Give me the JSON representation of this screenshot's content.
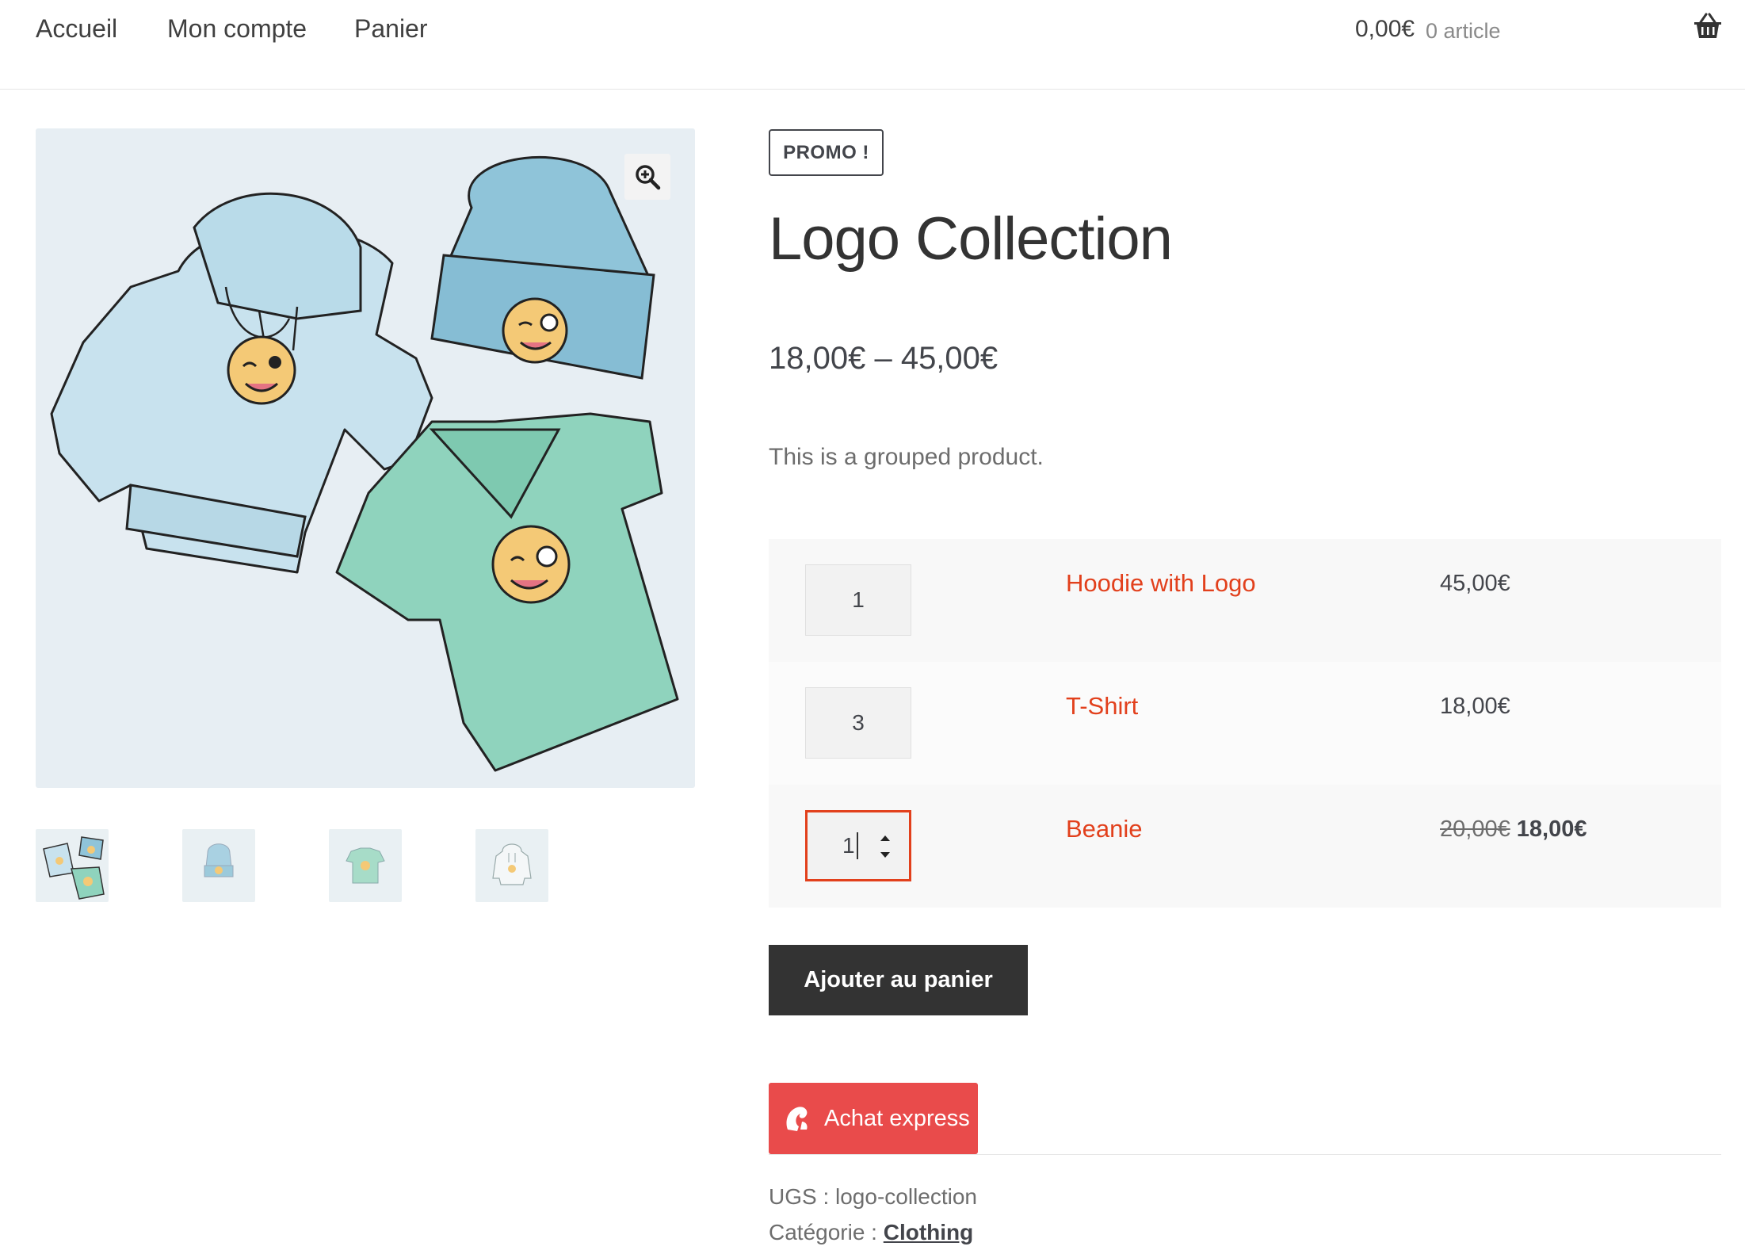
{
  "nav": {
    "items": [
      {
        "label": "Accueil"
      },
      {
        "label": "Mon compte"
      },
      {
        "label": "Panier"
      }
    ]
  },
  "cart": {
    "amount": "0,00€",
    "count": "0 article",
    "icon": "basket-icon"
  },
  "gallery": {
    "zoom_icon": "magnifier-plus-icon",
    "thumbnails": [
      "logo-collection",
      "beanie",
      "tshirt",
      "hoodie"
    ]
  },
  "product": {
    "badge": "PROMO !",
    "title": "Logo Collection",
    "price_range": "18,00€ – 45,00€",
    "short_description": "This is a grouped product.",
    "grouped_items": [
      {
        "qty": "1",
        "name": "Hoodie with Logo",
        "price": "45,00€",
        "old_price": "",
        "sale_price": ""
      },
      {
        "qty": "3",
        "name": "T-Shirt",
        "price": "18,00€",
        "old_price": "",
        "sale_price": ""
      },
      {
        "qty": "1",
        "name": "Beanie",
        "price": "",
        "old_price": "20,00€",
        "sale_price": "18,00€"
      }
    ],
    "add_to_cart_label": "Ajouter au panier",
    "express_label": "Achat express",
    "sku_label": "UGS :",
    "sku_value": "logo-collection",
    "category_label": "Catégorie :",
    "category_value": "Clothing"
  },
  "colors": {
    "accent": "#e2401c",
    "button_dark": "#333333",
    "express": "#e94b4b"
  }
}
